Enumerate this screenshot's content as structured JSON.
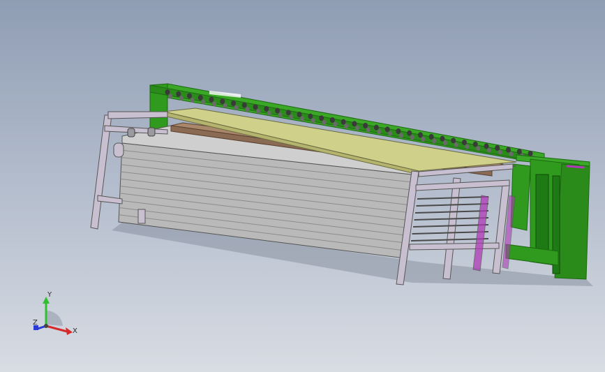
{
  "viewport": {
    "background_top": "#8f9db4",
    "background_bottom": "#d8dce3"
  },
  "model": {
    "colors": {
      "frame_green": "#2f9a1d",
      "frame_green_dark": "#1d6a12",
      "stack_gray": "#b9b9b9",
      "stack_gray_dark": "#8c8c8c",
      "platen_yellow": "#cfd08a",
      "board_brown": "#a9876a",
      "rack_lilac": "#c8c0d0",
      "accent_magenta": "#b03ab8",
      "roller_dark": "#3a3a3a"
    },
    "roller_count": 34,
    "stack_layers": 11
  },
  "triad": {
    "x_label": "X",
    "y_label": "Y",
    "z_label": "Z",
    "x_color": "#d42a2a",
    "y_color": "#2fbf2f",
    "z_color": "#2a3ad4"
  }
}
